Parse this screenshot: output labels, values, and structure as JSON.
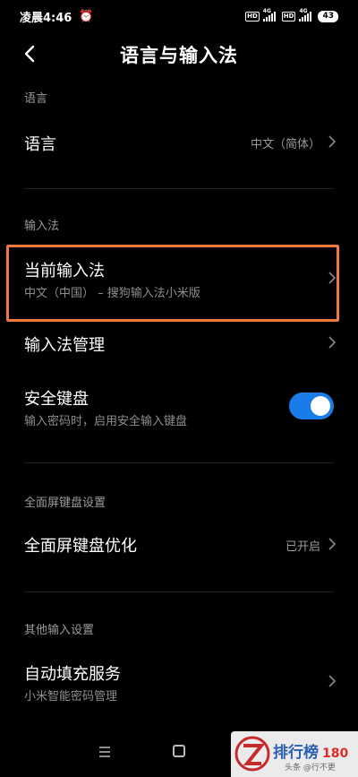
{
  "status_bar": {
    "time": "凌晨4:46",
    "alarm_icon": "alarm-icon",
    "hd1": "HD",
    "net1": "4G",
    "hd2": "HD",
    "net2": "4G",
    "battery": "43"
  },
  "header": {
    "title": "语言与输入法",
    "back_icon": "back-arrow-icon"
  },
  "sections": {
    "language": {
      "label": "语言"
    },
    "input_method": {
      "label": "输入法"
    },
    "fullscreen": {
      "label": "全面屏键盘设置"
    },
    "other": {
      "label": "其他输入设置"
    }
  },
  "rows": {
    "language": {
      "title": "语言",
      "value": "中文（简体）"
    },
    "current_ime": {
      "title": "当前输入法",
      "subtitle": "中文（中国） – 搜狗输入法小米版"
    },
    "ime_manage": {
      "title": "输入法管理"
    },
    "secure_keyboard": {
      "title": "安全键盘",
      "subtitle": "输入密码时，启用安全输入键盘",
      "enabled": true
    },
    "fullscreen_opt": {
      "title": "全面屏键盘优化",
      "value": "已开启"
    },
    "autofill": {
      "title": "自动填充服务",
      "subtitle": "小米智能密码管理"
    }
  },
  "colors": {
    "highlight": "#f07a3c",
    "toggle_on": "#1a7ce8"
  },
  "watermark": {
    "brand": "排行榜",
    "number": "180",
    "sub": "头条 @行不更"
  }
}
